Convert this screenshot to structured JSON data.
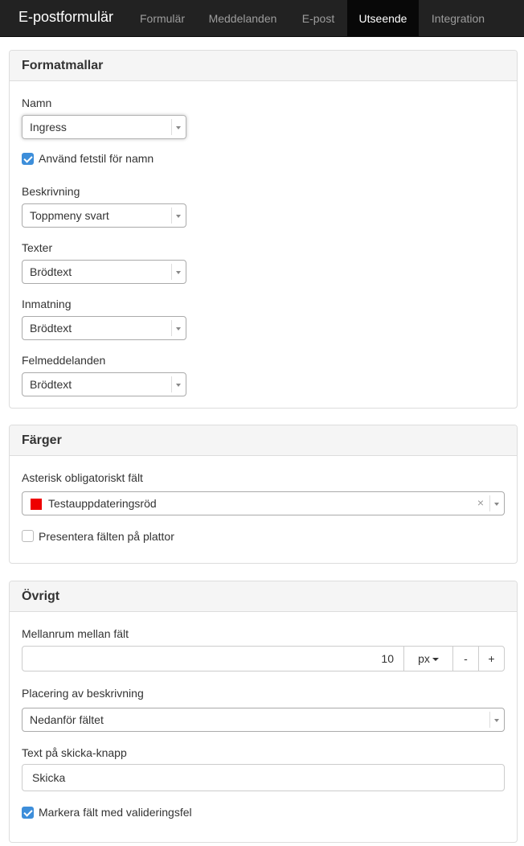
{
  "nav": {
    "brand": "E-postformulär",
    "tabs": [
      {
        "label": "Formulär",
        "active": false
      },
      {
        "label": "Meddelanden",
        "active": false
      },
      {
        "label": "E-post",
        "active": false
      },
      {
        "label": "Utseende",
        "active": true
      },
      {
        "label": "Integration",
        "active": false
      }
    ]
  },
  "formatmallar": {
    "title": "Formatmallar",
    "name_label": "Namn",
    "name_value": "Ingress",
    "bold_name_label": "Använd fetstil för namn",
    "bold_name_checked": true,
    "description_label": "Beskrivning",
    "description_value": "Toppmeny svart",
    "texts_label": "Texter",
    "texts_value": "Brödtext",
    "input_label": "Inmatning",
    "input_value": "Brödtext",
    "errors_label": "Felmeddelanden",
    "errors_value": "Brödtext"
  },
  "farger": {
    "title": "Färger",
    "asterisk_label": "Asterisk obligatoriskt fält",
    "asterisk_value": "Testauppdateringsröd",
    "asterisk_color": "#ee0000",
    "clear_symbol": "×",
    "tiles_label": "Presentera fälten på plattor",
    "tiles_checked": false
  },
  "ovrigt": {
    "title": "Övrigt",
    "spacing_label": "Mellanrum mellan fält",
    "spacing_value": "10",
    "spacing_unit": "px",
    "minus_label": "-",
    "plus_label": "+",
    "desc_placement_label": "Placering av beskrivning",
    "desc_placement_value": "Nedanför fältet",
    "submit_text_label": "Text på skicka-knapp",
    "submit_text_value": "Skicka",
    "mark_errors_label": "Markera fält med valideringsfel",
    "mark_errors_checked": true
  },
  "colors": {
    "nav_bg": "#222222",
    "nav_active_bg": "#080808",
    "checkbox_accent": "#3d8eda"
  }
}
